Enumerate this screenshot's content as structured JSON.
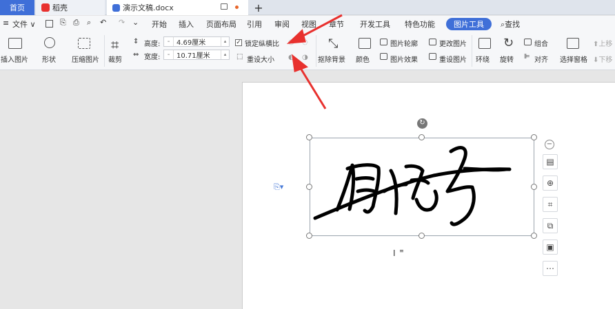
{
  "tabs": {
    "home": "首页",
    "docer": "稻壳",
    "document": "演示文稿.docx",
    "add": "+"
  },
  "menu": {
    "file": "文件",
    "items": [
      "开始",
      "插入",
      "页面布局",
      "引用",
      "审阅",
      "视图",
      "章节",
      "开发工具",
      "特色功能"
    ],
    "active": "图片工具",
    "search": "查找"
  },
  "ribbon": {
    "insert_picture": "插入图片",
    "shape": "形状",
    "compress": "压缩图片",
    "crop": "裁剪",
    "height_label": "高度:",
    "height_value": "4.69厘米",
    "width_label": "宽度:",
    "width_value": "10.71厘米",
    "lock_ratio": "锁定纵横比",
    "reset_size": "重设大小",
    "remove_bg": "抠除背景",
    "color": "颜色",
    "pic_outline": "图片轮廓",
    "pic_effect": "图片效果",
    "change_pic": "更改图片",
    "reset_pic": "重设图片",
    "wrap": "环绕",
    "rotate": "旋转",
    "group": "组合",
    "align": "对齐",
    "selection_pane": "选择窗格",
    "up": "上移",
    "down": "下移"
  },
  "colors": {
    "accent": "#3f6fd8",
    "arrow": "#e8312e",
    "tab_bg": "#dfe4ec",
    "ribbon_bg": "#f6f7f9"
  },
  "side_tools": [
    "minus-icon",
    "layout-icon",
    "zoom-icon",
    "crop-icon",
    "image-swap-icon",
    "image-edit-icon",
    "more-icon"
  ]
}
